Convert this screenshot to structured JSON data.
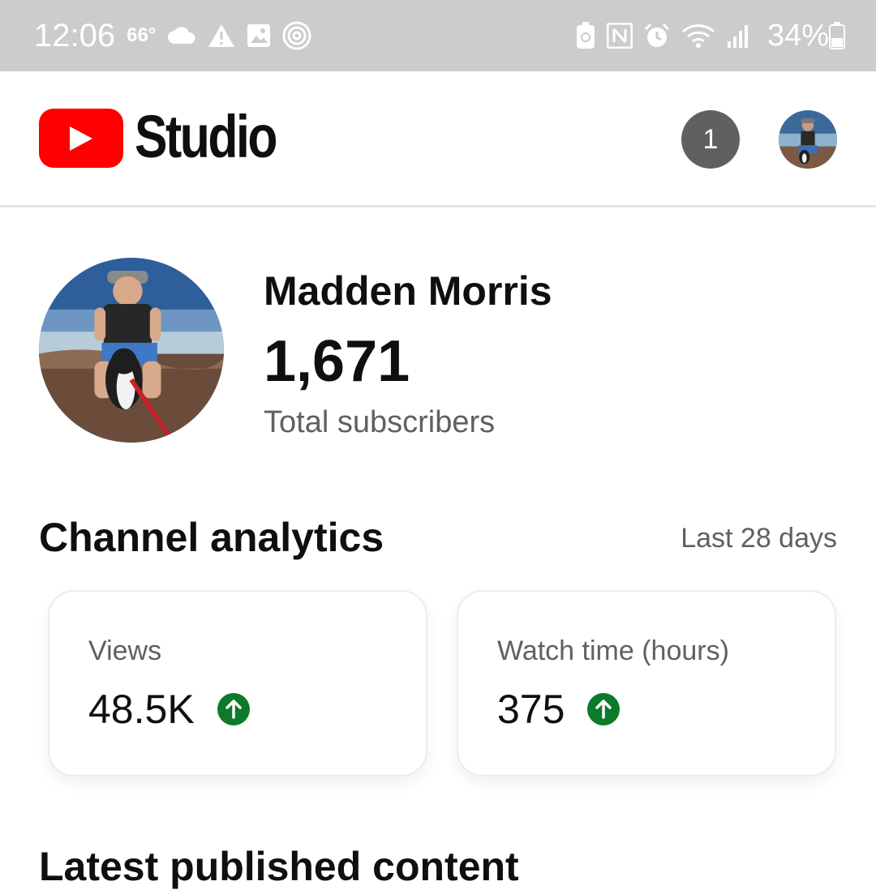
{
  "status_bar": {
    "time": "12:06",
    "temperature": "66°",
    "battery": "34%",
    "left_icons": [
      "cloud-icon",
      "warning-icon",
      "image-icon",
      "at-sign-icon"
    ],
    "right_icons": [
      "battery-saver-icon",
      "nfc-icon",
      "alarm-icon",
      "wifi-icon",
      "signal-icon",
      "battery-icon"
    ]
  },
  "header": {
    "app_name": "Studio",
    "notification_count": "1"
  },
  "channel": {
    "name": "Madden Morris",
    "subscriber_count": "1,671",
    "subscriber_label": "Total subscribers"
  },
  "analytics": {
    "title": "Channel analytics",
    "period": "Last 28 days",
    "metrics": [
      {
        "label": "Views",
        "value": "48.5K",
        "trend": "up"
      },
      {
        "label": "Watch time (hours)",
        "value": "375",
        "trend": "up"
      }
    ]
  },
  "latest": {
    "title": "Latest published content"
  },
  "colors": {
    "brand_red": "#ff0000",
    "trend_up_green": "#0b7a2a",
    "status_bar_bg": "#cccccc",
    "secondary_text": "#606060"
  }
}
